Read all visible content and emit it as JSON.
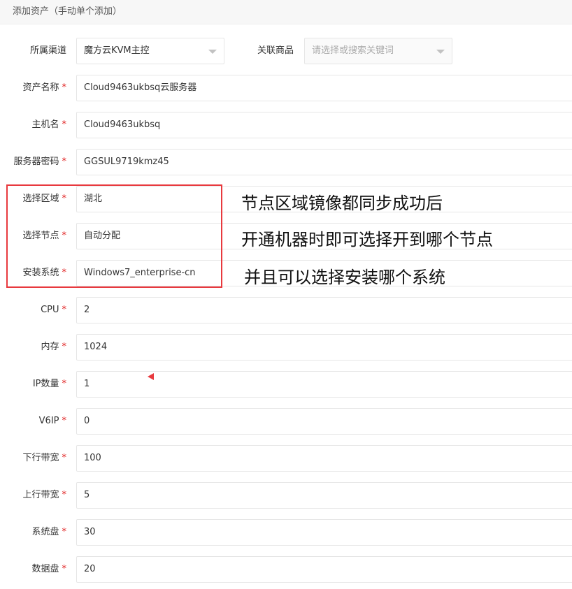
{
  "header": {
    "title": "添加资产（手动单个添加）"
  },
  "form": {
    "channel": {
      "label": "所属渠道",
      "value": "魔方云KVM主控"
    },
    "product": {
      "label": "关联商品",
      "placeholder": "请选择或搜索关键词"
    },
    "asset_name": {
      "label": "资产名称",
      "value": "Cloud9463ukbsq云服务器"
    },
    "hostname": {
      "label": "主机名",
      "value": "Cloud9463ukbsq"
    },
    "password": {
      "label": "服务器密码",
      "value": "GGSUL9719kmz45"
    },
    "region": {
      "label": "选择区域",
      "value": "湖北"
    },
    "node": {
      "label": "选择节点",
      "value": "自动分配"
    },
    "os": {
      "label": "安装系统",
      "value": "Windows7_enterprise-cn"
    },
    "cpu": {
      "label": "CPU",
      "value": "2"
    },
    "memory": {
      "label": "内存",
      "value": "1024"
    },
    "ip_count": {
      "label": "IP数量",
      "value": "1"
    },
    "v6ip": {
      "label": "V6IP",
      "value": "0"
    },
    "down_bw": {
      "label": "下行带宽",
      "value": "100"
    },
    "up_bw": {
      "label": "上行带宽",
      "value": "5"
    },
    "sys_disk": {
      "label": "系统盘",
      "value": "30"
    },
    "data_disk": {
      "label": "数据盘",
      "value": "20"
    },
    "required_mark": "*"
  },
  "annotations": {
    "line1": "节点区域镜像都同步成功后",
    "line2": "开通机器时即可选择开到哪个节点",
    "line3": "并且可以选择安装哪个系统"
  },
  "colors": {
    "required": "#e02020",
    "highlight": "#e8393e",
    "border": "#e6e6e6"
  }
}
